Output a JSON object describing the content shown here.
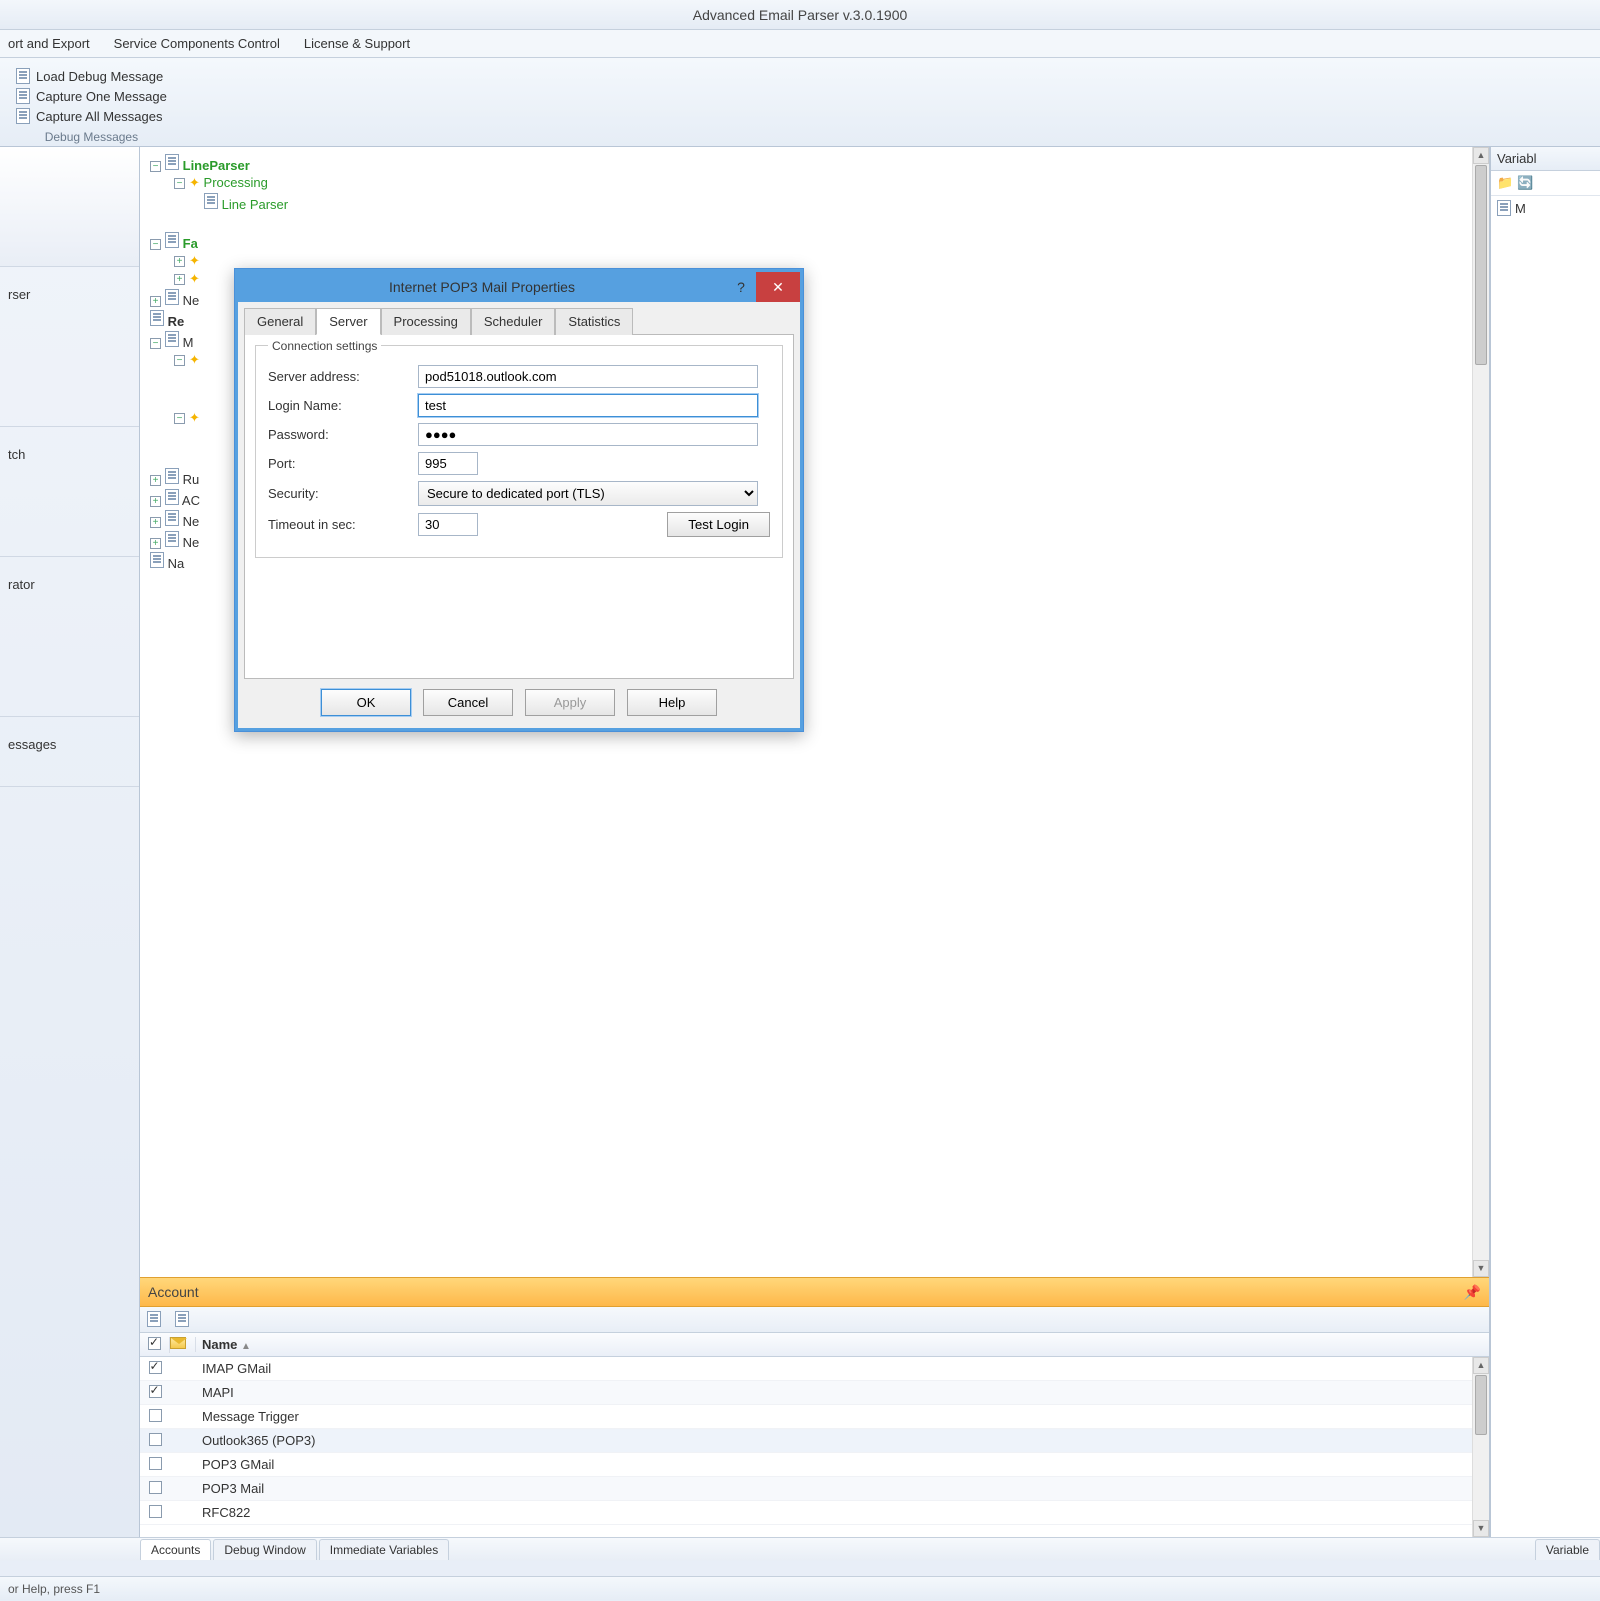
{
  "app": {
    "title": "Advanced Email Parser v.3.0.1900"
  },
  "menu": {
    "items": [
      "ort and Export",
      "Service Components Control",
      "License & Support"
    ]
  },
  "ribbon": {
    "group1": {
      "items": [
        "Load Debug Message",
        "Capture One Message",
        "Capture All Messages"
      ],
      "label": "Debug Messages"
    }
  },
  "left": {
    "items": [
      "",
      "",
      "rser",
      "",
      "tch",
      "",
      "rator",
      "",
      "essages"
    ]
  },
  "tree": {
    "n0": "LineParser",
    "n1": "Processing",
    "n2": "Line Parser",
    "n3": "Fa",
    "n4": "Ne",
    "n5": "Re",
    "n6": "M",
    "n7": "Ru",
    "n8": "AC",
    "n9": "Ne",
    "n10": "Ne",
    "n11": "Na"
  },
  "dialog": {
    "title": "Internet POP3 Mail Properties",
    "tabs": [
      "General",
      "Server",
      "Processing",
      "Scheduler",
      "Statistics"
    ],
    "active_tab": "Server",
    "fieldset": "Connection settings",
    "labels": {
      "server": "Server address:",
      "login": "Login Name:",
      "password": "Password:",
      "port": "Port:",
      "security": "Security:",
      "timeout": "Timeout in sec:"
    },
    "values": {
      "server": "pod51018.outlook.com",
      "login": "test",
      "password": "●●●●",
      "port": "995",
      "security": "Secure to dedicated port (TLS)",
      "timeout": "30"
    },
    "test_login": "Test Login",
    "buttons": {
      "ok": "OK",
      "cancel": "Cancel",
      "apply": "Apply",
      "help": "Help"
    }
  },
  "accounts": {
    "heading": "Account",
    "col_name": "Name",
    "rows": [
      {
        "checked": true,
        "name": "IMAP GMail"
      },
      {
        "checked": true,
        "name": "MAPI"
      },
      {
        "checked": false,
        "name": "Message Trigger"
      },
      {
        "checked": false,
        "name": "Outlook365 (POP3)",
        "sel": true
      },
      {
        "checked": false,
        "name": "POP3 GMail"
      },
      {
        "checked": false,
        "name": "POP3 Mail"
      },
      {
        "checked": false,
        "name": "RFC822"
      }
    ]
  },
  "bottom_tabs": [
    "Accounts",
    "Debug Window",
    "Immediate Variables"
  ],
  "right": {
    "header": "Variabl",
    "item": "M",
    "right_tab": "Variable"
  },
  "status": "or Help, press F1"
}
